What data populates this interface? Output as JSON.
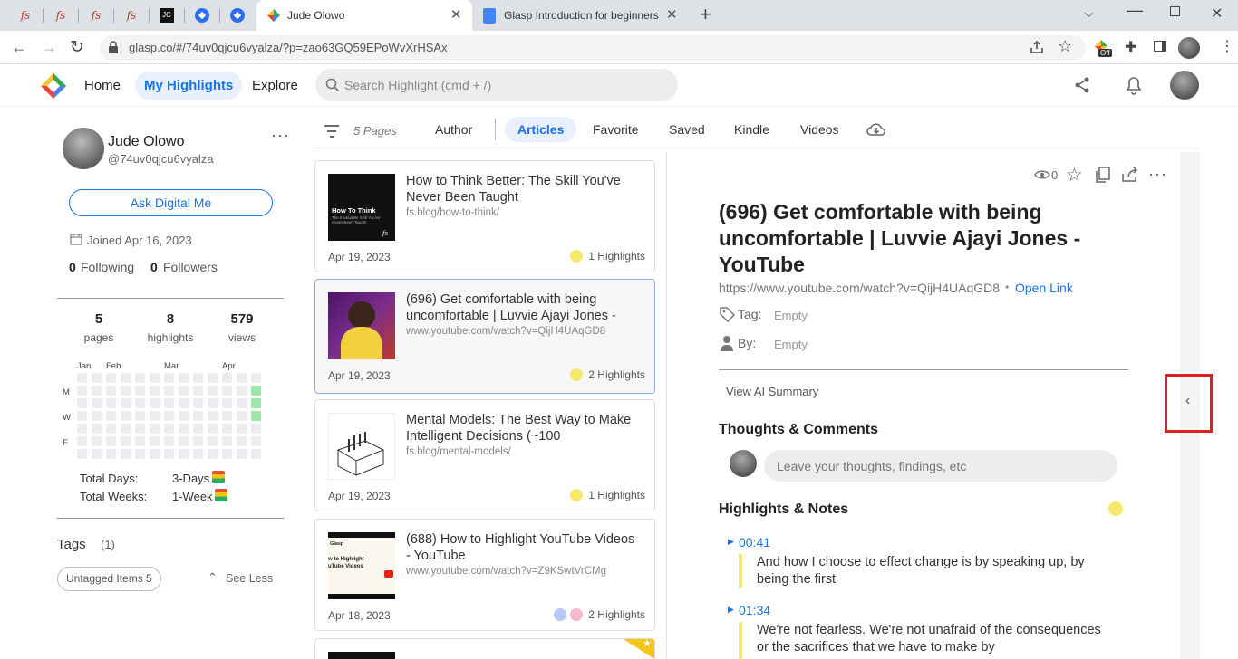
{
  "browser": {
    "tabs": [
      {
        "title": "Jude Olowo"
      },
      {
        "title": "Glasp Introduction for beginners"
      }
    ],
    "pinned_tab_labels": [
      "fs",
      "fs",
      "fs",
      "fs",
      "JC"
    ],
    "url": "glasp.co/#/74uv0qjcu6vyalza/?p=zao63GQ59EPoWvXrHSAx",
    "ext_badge": "Off"
  },
  "header": {
    "nav": [
      "Home",
      "My Highlights",
      "Explore"
    ],
    "search_placeholder": "Search Highlight (cmd + /)"
  },
  "profile": {
    "name": "Jude Olowo",
    "handle": "@74uv0qjcu6vyalza",
    "ask_button": "Ask Digital Me",
    "joined": "Joined Apr 16, 2023",
    "following_count": "0",
    "following_label": "Following",
    "followers_count": "0",
    "followers_label": "Followers",
    "stats": [
      {
        "num": "5",
        "label": "pages"
      },
      {
        "num": "8",
        "label": "highlights"
      },
      {
        "num": "579",
        "label": "views"
      }
    ],
    "heatmap_months": [
      "Jan",
      "Feb",
      "Mar",
      "Apr"
    ],
    "heatmap_days": [
      "M",
      "W",
      "F"
    ],
    "total_days_label": "Total Days:",
    "total_days_value": "3-Days",
    "total_weeks_label": "Total Weeks:",
    "total_weeks_value": "1-Week",
    "tags_label": "Tags",
    "tags_count": "(1)",
    "tag_chip": "Untagged Items 5",
    "see_less": "See Less"
  },
  "filters": {
    "pages_count": "5 Pages",
    "items": [
      "Author",
      "Articles",
      "Favorite",
      "Saved",
      "Kindle",
      "Videos"
    ],
    "active": "Articles"
  },
  "cards": [
    {
      "title": "How to Think Better: The Skill You've Never Been Taught",
      "url": "fs.blog/how-to-think/",
      "date": "Apr 19, 2023",
      "highlights": "1 Highlights",
      "thumb_title": "How To Think",
      "thumb_sub": "The Invaluable Skill You've Never Been Taught"
    },
    {
      "title": "(696) Get comfortable with being uncomfortable | Luvvie Ajayi Jones - YouTube",
      "url": "www.youtube.com/watch?v=QijH4UAqGD8",
      "date": "Apr 19, 2023",
      "highlights": "2 Highlights"
    },
    {
      "title": "Mental Models: The Best Way to Make Intelligent Decisions (~100",
      "url": "fs.blog/mental-models/",
      "date": "Apr 19, 2023",
      "highlights": "1 Highlights"
    },
    {
      "title": "(688) How to Highlight YouTube Videos - YouTube",
      "url": "www.youtube.com/watch?v=Z9KSwtVrCMg",
      "date": "Apr 18, 2023",
      "highlights": "2 Highlights",
      "thumb_brand": "Glasp",
      "thumb_title": "w to Highlight uTube Videos"
    }
  ],
  "detail": {
    "views": "0",
    "title": "(696) Get comfortable with being uncomfortable | Luvvie Ajayi Jones - YouTube",
    "url": "https://www.youtube.com/watch?v=QijH4UAqGD8",
    "open_link": "Open Link",
    "tag_label": "Tag:",
    "tag_value": "Empty",
    "by_label": "By:",
    "by_value": "Empty",
    "ai_summary": "View AI Summary",
    "thoughts_heading": "Thoughts & Comments",
    "thoughts_placeholder": "Leave your thoughts, findings, etc",
    "highlights_heading": "Highlights & Notes",
    "highlights": [
      {
        "time": "00:41",
        "text": "And how I choose to effect change is by speaking up, by being the first"
      },
      {
        "time": "01:34",
        "text": "We're not fearless. We're not unafraid of the consequences or the sacrifices that we have to make by"
      }
    ]
  },
  "colors": {
    "accent": "#1a73e8",
    "highlight": "#f5e96b",
    "collapse_border": "#e02020"
  }
}
